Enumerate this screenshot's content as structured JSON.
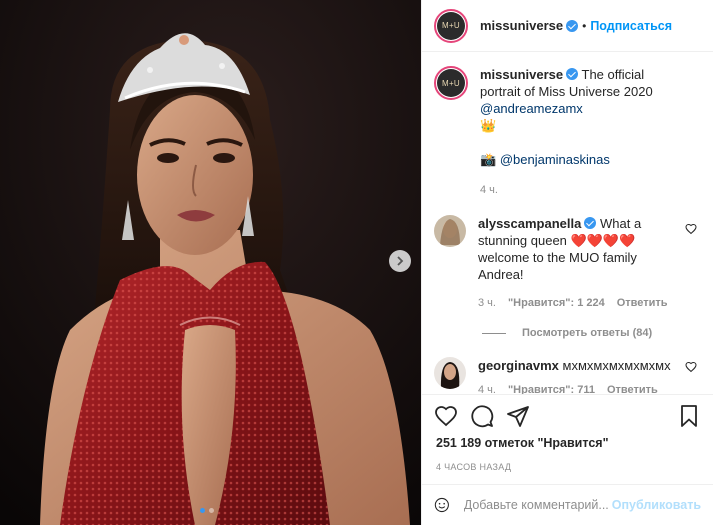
{
  "post": {
    "account": "missuniverse",
    "avatar_text": "M+U",
    "follow_label": "Подписаться",
    "separator": "•",
    "caption": {
      "username": "missuniverse",
      "text_a": "The official portrait of Miss Universe 2020",
      "mention_main": "@andreamezamx",
      "crown_emoji": "👑",
      "camera_emoji": "📸",
      "mention_photographer": "@benjaminaskinas",
      "time": "4 ч."
    },
    "comments": [
      {
        "username": "alysscampanella",
        "text": "What a stunning queen ❤️❤️❤️❤️ welcome to the MUO family Andrea!",
        "time": "3 ч.",
        "likes": "\"Нравится\": 1 224",
        "reply": "Ответить",
        "view_replies": "Посмотреть ответы (84)"
      },
      {
        "username": "georginavmx",
        "text": "мхмхмхмхмхмхмх",
        "time": "4 ч.",
        "likes": "\"Нравится\": 711",
        "reply": "Ответить"
      }
    ],
    "likes_count": "251 189 отметок \"Нравится\"",
    "posted_ago": "4 ЧАСОВ НАЗАД",
    "comment_placeholder": "Добавьте комментарий...",
    "publish_label": "Опубликовать"
  },
  "colors": {
    "accent": "#0095f6",
    "verified": "#3897f0",
    "heart_red": "#ed4956"
  },
  "icons": [
    "next-arrow-icon",
    "verified-icon",
    "heart-icon",
    "comment-icon",
    "share-icon",
    "bookmark-icon",
    "emoji-icon"
  ]
}
